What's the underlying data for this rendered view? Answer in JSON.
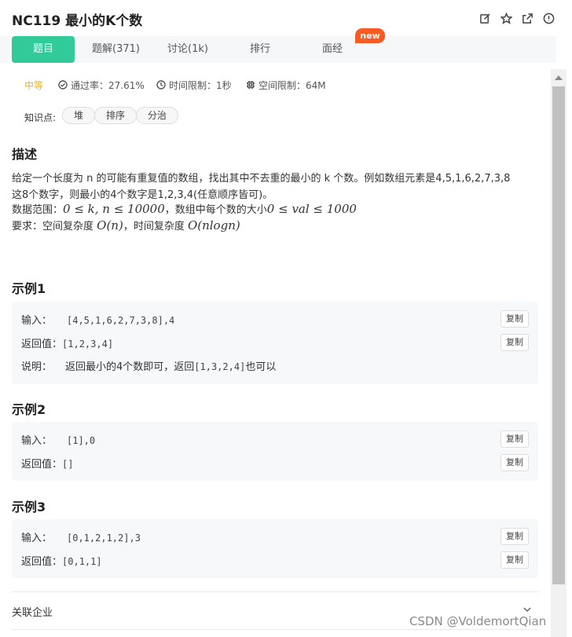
{
  "header": {
    "title": "NC119  最小的K个数",
    "icons": [
      "edit-icon",
      "star-icon",
      "share-icon",
      "info-icon"
    ]
  },
  "tabs": [
    {
      "label": "题目",
      "active": true
    },
    {
      "label": "题解(371)"
    },
    {
      "label": "讨论(1k)"
    },
    {
      "label": "排行"
    },
    {
      "label": "面经"
    }
  ],
  "badge_new": "new",
  "meta": {
    "difficulty": "中等",
    "pass_rate": "通过率：27.61%",
    "time_limit": "时间限制：1秒",
    "memory_limit": "空间限制：64M"
  },
  "knowledge": {
    "label": "知识点:",
    "tags": [
      "堆",
      "排序",
      "分治"
    ]
  },
  "description": {
    "title": "描述",
    "line1": "给定一个长度为 n 的可能有重复值的数组，找出其中不去重的最小的 k 个数。例如数组元素是4,5,1,6,2,7,3,8",
    "line2": "这8个数字，则最小的4个数字是1,2,3,4(任意顺序皆可)。",
    "range_prefix": "数据范围：",
    "range_math1": "0 ≤ k, n ≤ 10000",
    "range_mid": "，数组中每个数的大小",
    "range_math2": "0 ≤ val ≤ 1000",
    "req_prefix": "要求：空间复杂度 ",
    "req_math1": "O(n)",
    "req_mid": "，时间复杂度 ",
    "req_math2": "O(nlogn)"
  },
  "examples": [
    {
      "title": "示例1",
      "input_label": "输入：",
      "input": "[4,5,1,6,2,7,3,8],4",
      "output_label": "返回值：",
      "output": "[1,2,3,4]",
      "explain_label": "说明：",
      "explain_pre": "返回最小的4个数即可，返回",
      "explain_code": "[1,3,2,4]",
      "explain_post": "也可以"
    },
    {
      "title": "示例2",
      "input_label": "输入：",
      "input": "[1],0",
      "output_label": "返回值：",
      "output": "[]"
    },
    {
      "title": "示例3",
      "input_label": "输入：",
      "input": "[0,1,2,1,2],3",
      "output_label": "返回值：",
      "output": "[0,1,1]"
    }
  ],
  "copy_label": "复制",
  "company_label": "关联企业",
  "watermark": "CSDN @VoldemortQian",
  "colors": {
    "accent": "#32ca99",
    "badge": "#fa5b23",
    "difficulty": "#e8b32b"
  }
}
